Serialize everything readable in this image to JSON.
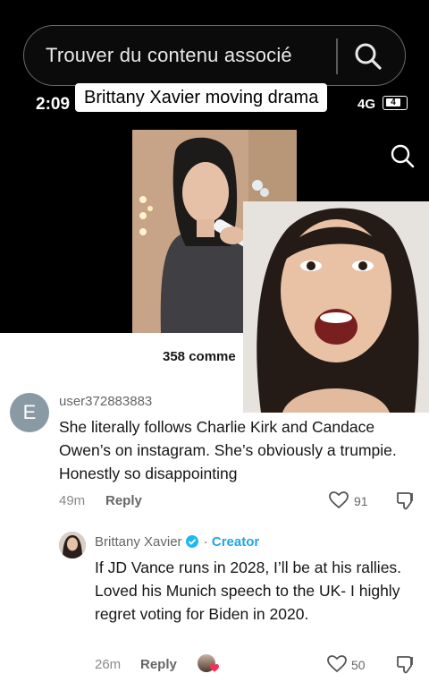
{
  "search": {
    "placeholder_text": "Trouver du contenu associé",
    "icon": "search-icon"
  },
  "status": {
    "time": "2:09",
    "network": "4G",
    "battery": "4"
  },
  "caption": "Brittany Xavier moving drama",
  "top_icon": "search-icon",
  "comments": {
    "count_label": "358 comme",
    "items": [
      {
        "avatar_letter": "E",
        "username": "user372883883",
        "text": "She literally follows Charlie Kirk and Candace Owen’s on instagram. She’s obviously a trumpie. Honestly so disappointing",
        "time": "49m",
        "reply_label": "Reply",
        "likes": "91",
        "avatar_color": "#8a9aa5"
      },
      {
        "username": "Brittany Xavier",
        "creator_label": "Creator",
        "separator": "·",
        "text": "If JD Vance runs in 2028, I’ll be at his rallies. Loved his Munich speech to the UK- I highly regret voting for Biden in 2020.",
        "time": "26m",
        "reply_label": "Reply",
        "likes": "50",
        "verified_color": "#20b8f2"
      }
    ]
  }
}
